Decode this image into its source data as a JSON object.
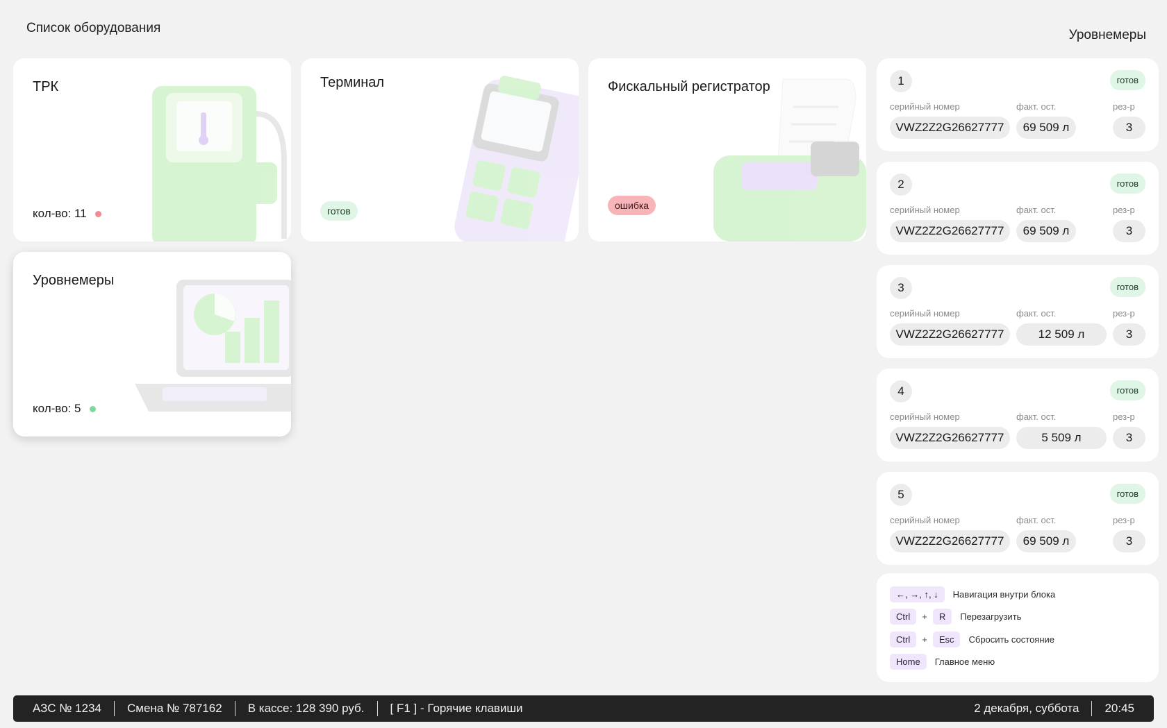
{
  "page_title": "Список оборудования",
  "panel_title": "Уровнемеры",
  "equipment": [
    {
      "title": "ТРК",
      "qty_label": "кол-во: 11",
      "dot_color": "#f08a8f",
      "icon": "fuel-dispenser-illustration"
    },
    {
      "title": "Терминал",
      "badge": "готов",
      "icon": "payment-terminal-illustration"
    },
    {
      "title": "Фискальный регистратор",
      "badge": "ошибка",
      "icon": "receipt-printer-illustration"
    },
    {
      "title": "Уровнемеры",
      "qty_label": "кол-во: 5",
      "dot_color": "#7ed99a",
      "icon": "laptop-chart-illustration"
    }
  ],
  "columns": {
    "serial": "серийный номер",
    "fact": "факт. ост.",
    "tank": "рез-р"
  },
  "devices": [
    {
      "num": "1",
      "status": "готов",
      "serial": "VWZ2Z2G26627777",
      "fact": "69 509 л",
      "tank": "3"
    },
    {
      "num": "2",
      "status": "готов",
      "serial": "VWZ2Z2G26627777",
      "fact": "69 509 л",
      "tank": "3"
    },
    {
      "num": "3",
      "status": "готов",
      "serial": "VWZ2Z2G26627777",
      "fact": "12 509 л",
      "tank": "3"
    },
    {
      "num": "4",
      "status": "готов",
      "serial": "VWZ2Z2G26627777",
      "fact": "5 509 л",
      "tank": "3"
    },
    {
      "num": "5",
      "status": "готов",
      "serial": "VWZ2Z2G26627777",
      "fact": "69 509 л",
      "tank": "3"
    }
  ],
  "hotkeys": {
    "nav_keys": "←, →, ↑, ↓",
    "nav_desc": "Навигация внутри блока",
    "ctrl": "Ctrl",
    "plus": "+",
    "reload_key": "R",
    "reload_desc": "Перезагрузить",
    "reset_key": "Esc",
    "reset_desc": "Сбросить состояние",
    "home_key": "Home",
    "home_desc": "Главное меню"
  },
  "statusbar": {
    "station": "АЗС № 1234",
    "shift": "Смена № 787162",
    "cash": "В кассе: 128 390 руб.",
    "hotkeys_hint": "[ F1 ] - Горячие клавиши",
    "date": "2 декабря, суббота",
    "time": "20:45"
  }
}
